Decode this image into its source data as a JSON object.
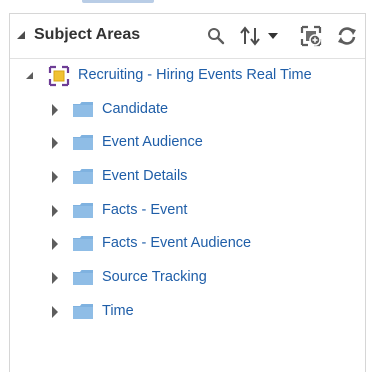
{
  "panel": {
    "title": "Subject Areas",
    "toolbar": {
      "search_icon": "search-icon",
      "sort_icon": "sort-icon",
      "sort_menu_icon": "caret-down-icon",
      "add_icon": "add-subject-area-icon",
      "refresh_icon": "refresh-icon"
    }
  },
  "tree": {
    "root": {
      "label": "Recruiting - Hiring Events Real Time",
      "icon": "subject-area-icon",
      "expanded": true
    },
    "children": [
      {
        "label": "Candidate",
        "icon": "folder-icon"
      },
      {
        "label": "Event Audience",
        "icon": "folder-icon"
      },
      {
        "label": "Event Details",
        "icon": "folder-icon"
      },
      {
        "label": "Facts - Event",
        "icon": "folder-icon"
      },
      {
        "label": "Facts - Event Audience",
        "icon": "folder-icon"
      },
      {
        "label": "Source Tracking",
        "icon": "folder-icon"
      },
      {
        "label": "Time",
        "icon": "folder-icon"
      }
    ]
  },
  "colors": {
    "link": "#1f5ea8",
    "folder": "#7fb2e0",
    "icon": "#5d5d5d"
  }
}
